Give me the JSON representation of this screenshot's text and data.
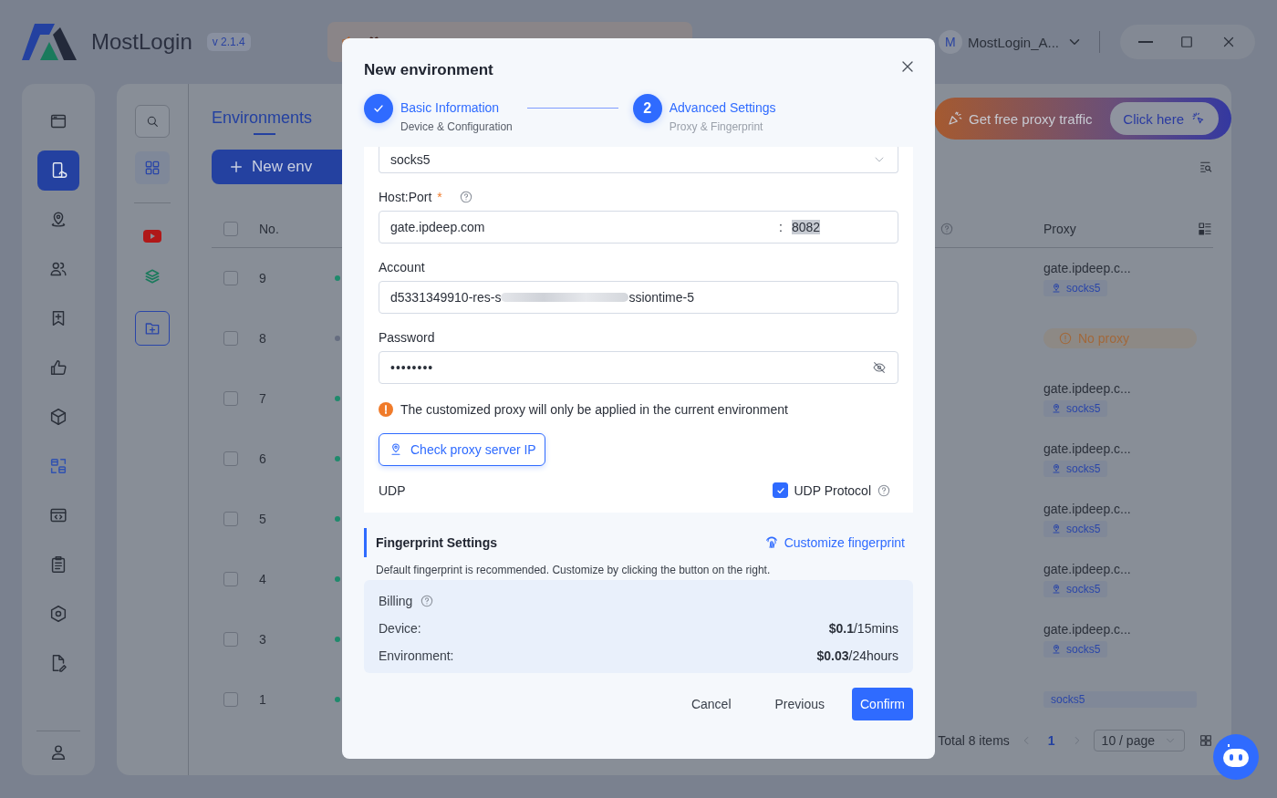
{
  "app": {
    "name": "MostLogin",
    "version": "v 2.1.4"
  },
  "user": {
    "initial": "M",
    "name": "MostLogin_A..."
  },
  "nav": [
    {
      "selected": false,
      "highlighted": false
    },
    {
      "selected": true,
      "highlighted": false
    },
    {
      "selected": false,
      "highlighted": false
    },
    {
      "selected": false,
      "highlighted": false
    },
    {
      "selected": false,
      "highlighted": false
    },
    {
      "selected": false,
      "highlighted": false
    },
    {
      "selected": false,
      "highlighted": false
    },
    {
      "selected": false,
      "highlighted": true
    },
    {
      "selected": false,
      "highlighted": false
    },
    {
      "selected": false,
      "highlighted": false
    },
    {
      "selected": false,
      "highlighted": false
    },
    {
      "selected": false,
      "highlighted": false
    }
  ],
  "tab": {
    "label": "Environments",
    "selected": true
  },
  "new_env_button": "New env",
  "promo": {
    "text": "Get free proxy traffic",
    "button": "Click here"
  },
  "table": {
    "columns": [
      "No.",
      "Proxy"
    ],
    "all_checked": false,
    "rows": [
      {
        "no": "9",
        "checked": false,
        "color": "#1f8a6c",
        "kind": "proxy",
        "proxy": "gate.ipdeep.c...",
        "tag": "socks5"
      },
      {
        "no": "8",
        "checked": false,
        "color": "#666d80",
        "kind": "none",
        "proxy": "No proxy"
      },
      {
        "no": "7",
        "checked": false,
        "color": "#1f8a6c",
        "kind": "proxy",
        "proxy": "gate.ipdeep.c...",
        "tag": "socks5"
      },
      {
        "no": "6",
        "checked": false,
        "color": "#1f8a6c",
        "kind": "proxy",
        "proxy": "gate.ipdeep.c...",
        "tag": "socks5"
      },
      {
        "no": "5",
        "checked": false,
        "color": "#1f8a6c",
        "kind": "proxy",
        "proxy": "gate.ipdeep.c...",
        "tag": "socks5"
      },
      {
        "no": "4",
        "checked": false,
        "color": "#1f8a6c",
        "kind": "proxy",
        "proxy": "gate.ipdeep.c...",
        "tag": "socks5"
      },
      {
        "no": "3",
        "checked": false,
        "color": "#1f8a6c",
        "kind": "proxy",
        "proxy": "gate.ipdeep.c...",
        "tag": "socks5"
      },
      {
        "no": "1",
        "checked": false,
        "color": "#1f8a6c",
        "kind": "tag",
        "tag": "socks5"
      }
    ]
  },
  "pagination": {
    "total": "Total 8 items",
    "pages": [
      {
        "label": "1",
        "selected": true
      }
    ],
    "page_size": "10 / page"
  },
  "modal": {
    "title": "New environment",
    "steps": [
      {
        "title": "Basic Information",
        "subtitle": "Device & Configuration",
        "done": true
      },
      {
        "number": "2",
        "title": "Advanced Settings",
        "subtitle": "Proxy & Fingerprint",
        "done": false
      }
    ],
    "proxy_type": {
      "value": "socks5"
    },
    "host_port": {
      "label": "Host:Port",
      "required_mark": "*",
      "host": "gate.ipdeep.com",
      "separator": ":",
      "port": "8082",
      "port_highlighted": true
    },
    "account": {
      "label": "Account",
      "parts": [
        "d5331349910-res-s",
        "ssiontime-5"
      ]
    },
    "password": {
      "label": "Password",
      "value": "••••••••"
    },
    "notice": "The customized proxy will only be applied in the current environment",
    "check_button": "Check proxy server IP",
    "udp": {
      "label": "UDP",
      "option": "UDP Protocol",
      "checked": true
    },
    "fingerprint": {
      "title": "Fingerprint Settings",
      "link": "Customize fingerprint",
      "description": "Default fingerprint is recommended. Customize by clicking the button on the right."
    },
    "billing": {
      "title": "Billing",
      "items": [
        {
          "label": "Device:",
          "price": "**$0.1**/15mins"
        },
        {
          "label": "Environment:",
          "price": "**$0.03**/24hours"
        }
      ]
    },
    "buttons": [
      {
        "label": "Cancel",
        "kind": "text"
      },
      {
        "label": "Previous",
        "kind": "text"
      },
      {
        "label": "Confirm",
        "kind": "primary"
      }
    ]
  }
}
